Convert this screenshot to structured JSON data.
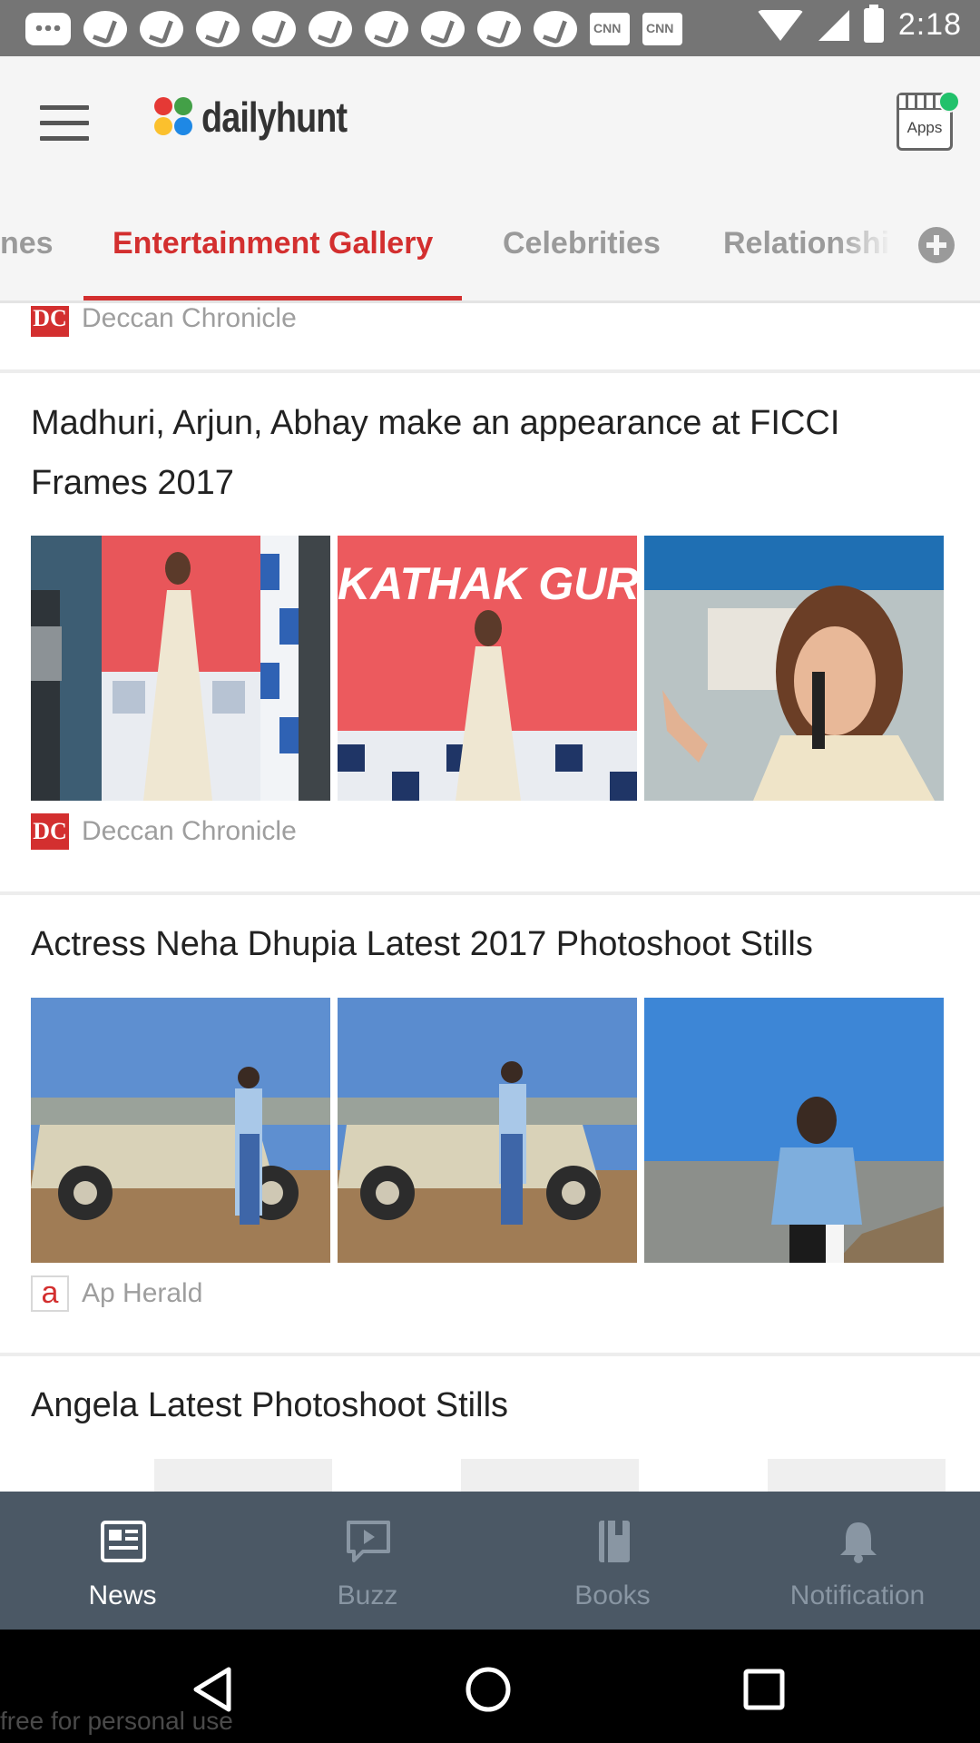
{
  "status_bar": {
    "time": "2:18",
    "notification_icons": [
      "message-icon",
      "tune-icon",
      "tune-icon",
      "tune-icon",
      "tune-icon",
      "tune-icon",
      "tune-icon",
      "tune-icon",
      "tune-icon",
      "tune-icon",
      "cnn-icon",
      "cnn-icon"
    ]
  },
  "app_bar": {
    "logo_text": "dailyhunt",
    "apps_label": "Apps"
  },
  "tabs": [
    {
      "label": "nes",
      "active": false
    },
    {
      "label": "Entertainment Gallery",
      "active": true
    },
    {
      "label": "Celebrities",
      "active": false
    },
    {
      "label": "Relationshi",
      "active": false
    }
  ],
  "feed": {
    "top_source": {
      "logo": "DC",
      "name": "Deccan Chronicle"
    },
    "articles": [
      {
        "title": "Madhuri, Arjun, Abhay make an appearance at FICCI Frames 2017",
        "photos": [
          "Madhuri at event",
          "KATHAK GURU, PA",
          "Madhuri speaking"
        ],
        "source_logo": "DC",
        "source": "Deccan Chronicle"
      },
      {
        "title": "Actress Neha Dhupia Latest 2017 Photoshoot Stills",
        "photos": [
          "Neha with jeep",
          "Neha on jeep",
          "Neha by lake"
        ],
        "source_logo": "a",
        "source": "Ap Herald"
      },
      {
        "title": "Angela Latest Photoshoot Stills"
      }
    ]
  },
  "bottom_nav": [
    {
      "label": "News",
      "icon": "newspaper-icon",
      "active": true
    },
    {
      "label": "Buzz",
      "icon": "play-icon",
      "active": false
    },
    {
      "label": "Books",
      "icon": "book-icon",
      "active": false
    },
    {
      "label": "Notification",
      "icon": "bell-icon",
      "active": false
    }
  ],
  "watermark": "free for personal use",
  "colors": {
    "accent": "#d32f2f",
    "status_bar": "#757575",
    "bottom_nav_bg": "#4b5865",
    "nav_inactive": "#8996a3"
  }
}
